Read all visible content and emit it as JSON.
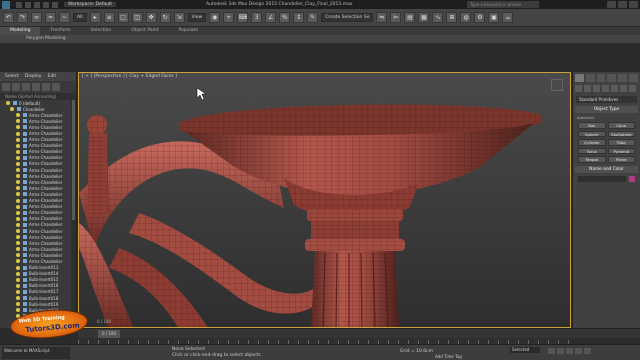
{
  "titlebar": {
    "workspace": "Workspace: Default",
    "title": "Autodesk 3ds Max Design 2015   Chandelier_Clay_Final_2013.max",
    "search_placeholder": "Type a keyword or phrase"
  },
  "toolbar": {
    "selection_filter": "All",
    "view_dropdown": "View",
    "named_selection": "Create Selection Se"
  },
  "ribbon": {
    "tabs": [
      "Modeling",
      "Freeform",
      "Selection",
      "Object Paint",
      "Populate"
    ],
    "active_tab": "Modeling",
    "sub_label": "Polygon Modeling"
  },
  "explorer": {
    "menu": [
      "Select",
      "Display",
      "Edit"
    ],
    "column_header": "Name (Sorted Ascending)",
    "items": [
      {
        "label": "0 (default)",
        "level": "top"
      },
      {
        "label": "Chandelier",
        "level": "top2"
      },
      {
        "label": "Arms-Chandelier"
      },
      {
        "label": "Arms-Chandelier"
      },
      {
        "label": "Arms-Chandelier"
      },
      {
        "label": "Arms-Chandelier"
      },
      {
        "label": "Arms-Chandelier"
      },
      {
        "label": "Arms-Chandelier"
      },
      {
        "label": "Arms-Chandelier"
      },
      {
        "label": "Arms-Chandelier"
      },
      {
        "label": "Arms-Chandelier"
      },
      {
        "label": "Arms-Chandelier"
      },
      {
        "label": "Arms-Chandelier"
      },
      {
        "label": "Arms-Chandelier"
      },
      {
        "label": "Arms-Chandelier"
      },
      {
        "label": "Arms-Chandelier"
      },
      {
        "label": "Arms-Chandelier"
      },
      {
        "label": "Arms-Chandelier"
      },
      {
        "label": "Arms-Chandelier"
      },
      {
        "label": "Arms-Chandelier"
      },
      {
        "label": "Arms-Chandelier"
      },
      {
        "label": "Arms-Chandelier"
      },
      {
        "label": "Arms-Chandelier"
      },
      {
        "label": "Arms-Chandelier"
      },
      {
        "label": "Arms-Chandelier"
      },
      {
        "label": "Arms-Chandelier"
      },
      {
        "label": "Arms-Chandelier"
      },
      {
        "label": "Bulb-Insert013"
      },
      {
        "label": "Bulb-Insert014"
      },
      {
        "label": "Bulb-Insert015"
      },
      {
        "label": "Bulb-Insert016"
      },
      {
        "label": "Bulb-Insert017"
      },
      {
        "label": "Bulb-Insert018"
      },
      {
        "label": "Bulb-Insert019"
      },
      {
        "label": "Bulb-Insert020"
      },
      {
        "label": "Bulb-Insert021"
      },
      {
        "label": "Bulb-Insert022"
      },
      {
        "label": "Bulb-Insert023"
      }
    ]
  },
  "viewport": {
    "label": "[ + ] [Perspective ] [ Clay + Edged Faces ]",
    "corner": "0 / 100"
  },
  "command_panel": {
    "category": "Standard Primitives",
    "rollout_object_type": "Object Type",
    "autogrid": "AutoGrid",
    "buttons": [
      "Box",
      "Cone",
      "Sphere",
      "GeoSphere",
      "Cylinder",
      "Tube",
      "Torus",
      "Pyramid",
      "Teapot",
      "Plane"
    ],
    "rollout_name_color": "Name and Color"
  },
  "status": {
    "maxscript": "Welcome to MAXScript.",
    "selection": "None Selected",
    "prompt": "Click or click-and-drag to select objects",
    "grid": "Grid = 10.0cm",
    "add_time_tag": "Add Time Tag",
    "key_filter": "Selected"
  },
  "watermark": {
    "line1": "Web 3D Training",
    "line2": "Tutors3D.com"
  }
}
